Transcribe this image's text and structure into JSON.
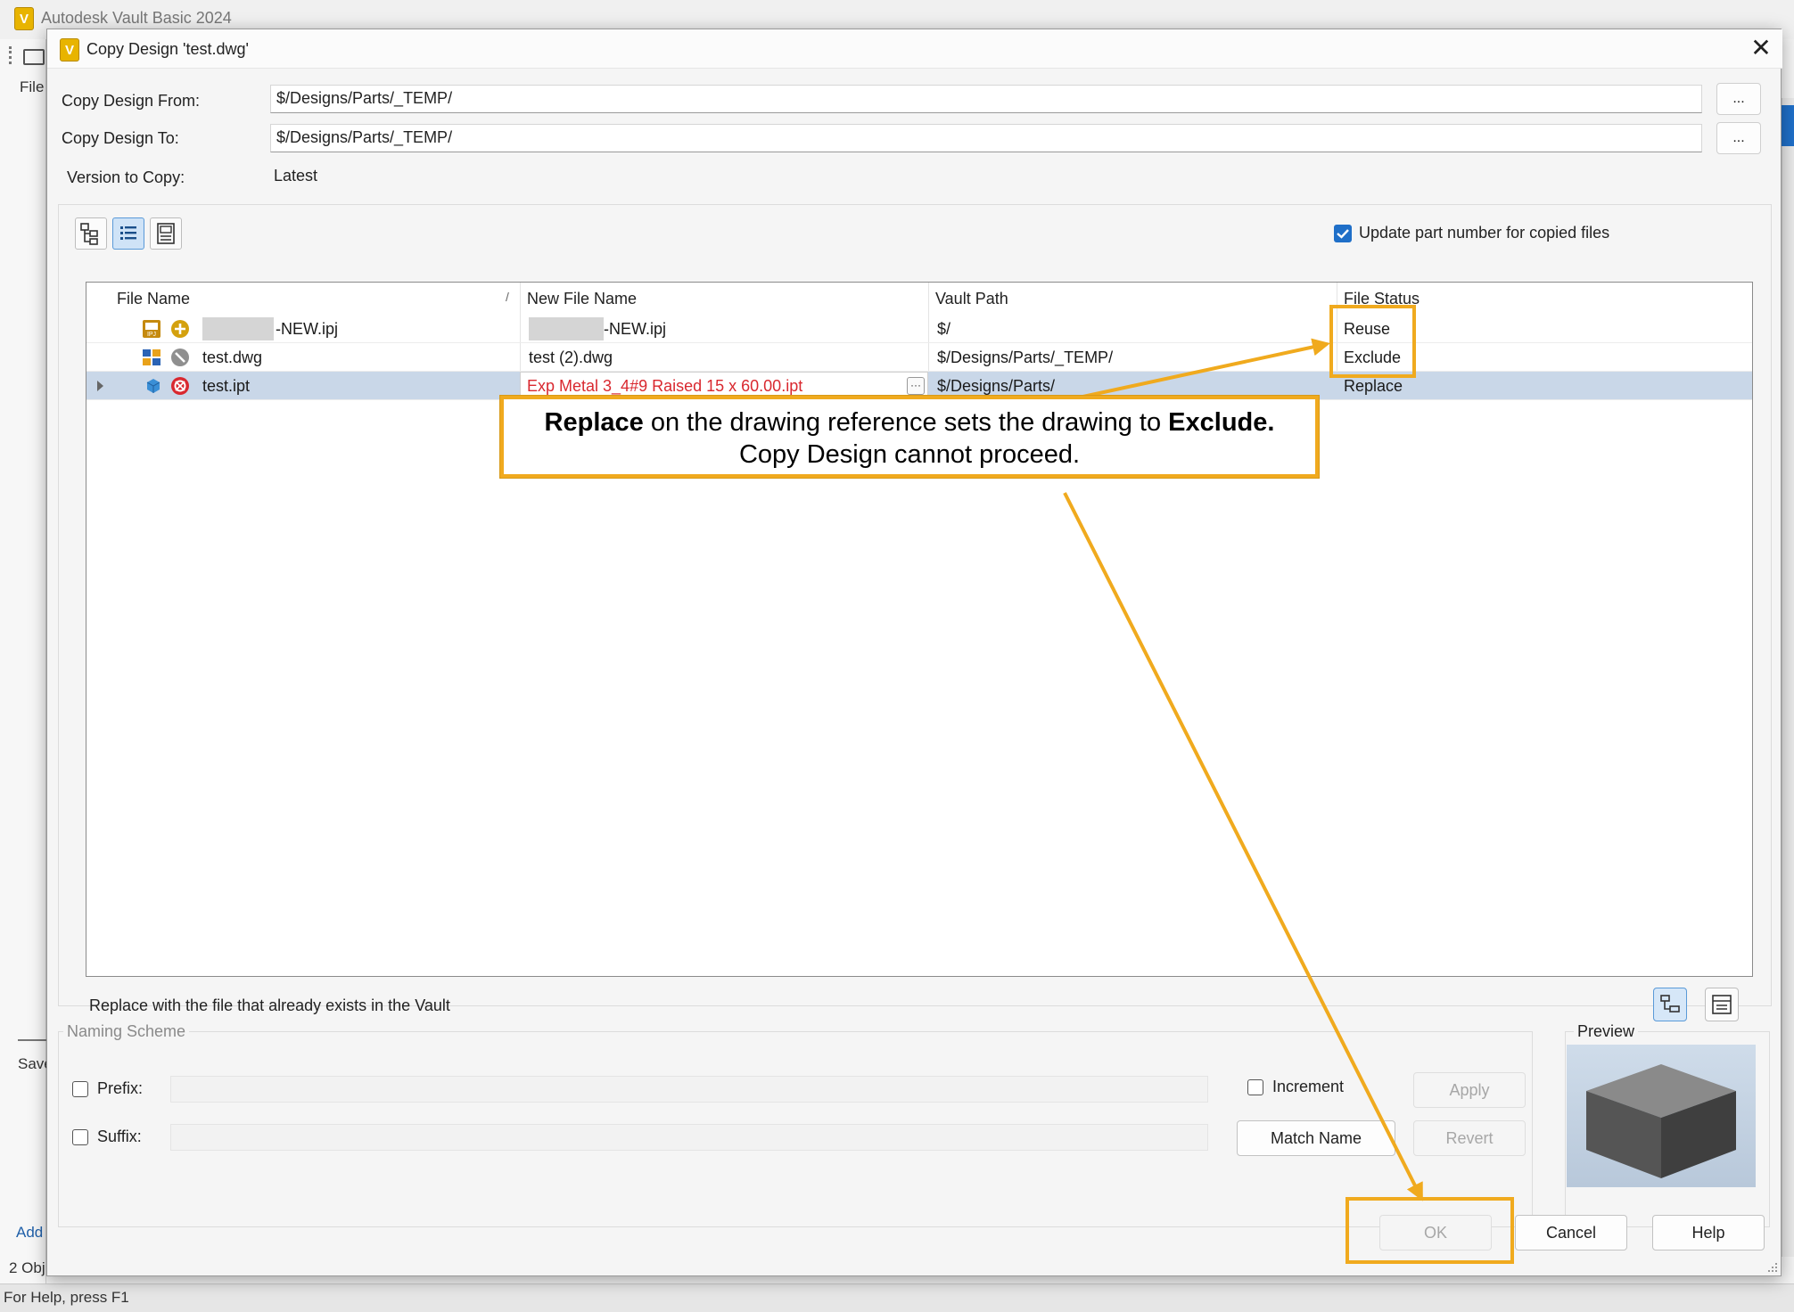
{
  "background_app": {
    "title": "Autodesk Vault Basic 2024",
    "file_menu": "File",
    "save_fragment": "Save",
    "add_fragment": "Add",
    "objects_fragment": "2 Obj",
    "status_bar": "For Help, press F1"
  },
  "dialog": {
    "title": "Copy Design 'test.dwg'",
    "close_glyph": "✕",
    "copy_from_label": "Copy Design From:",
    "copy_from_value": "$/Designs/Parts/_TEMP/",
    "copy_to_label": "Copy Design To:",
    "copy_to_value": "$/Designs/Parts/_TEMP/",
    "browse_label": "...",
    "version_label": "Version to Copy:",
    "version_value": "Latest",
    "update_part_number_label": "Update part number for copied files",
    "update_part_number_checked": true
  },
  "grid": {
    "headers": {
      "file_name": "File Name",
      "sort_glyph": "/",
      "new_file_name": "New File Name",
      "vault_path": "Vault Path",
      "file_status": "File Status"
    },
    "rows": [
      {
        "file_name": "-NEW.ipj",
        "new_file_name": "-NEW.ipj",
        "vault_path": "$/",
        "file_status": "Reuse",
        "file_icon": "project-file-icon",
        "status_icon": "reuse-status-icon"
      },
      {
        "file_name": "test.dwg",
        "new_file_name": "test (2).dwg",
        "vault_path": "$/Designs/Parts/_TEMP/",
        "file_status": "Exclude",
        "file_icon": "drawing-file-icon",
        "status_icon": "exclude-status-icon"
      },
      {
        "file_name": "test.ipt",
        "new_file_name": "Exp Metal 3_4#9 Raised 15 x 60.00.ipt",
        "vault_path": "$/Designs/Parts/",
        "file_status": "Replace",
        "file_icon": "part-file-icon",
        "status_icon": "replace-status-icon",
        "edit_glyph": "···"
      }
    ]
  },
  "hint_text": "Replace with the file that already exists in the Vault",
  "naming_scheme": {
    "title": "Naming Scheme",
    "prefix_label": "Prefix:",
    "suffix_label": "Suffix:",
    "increment_label": "Increment",
    "apply_label": "Apply",
    "match_name_label": "Match Name",
    "revert_label": "Revert"
  },
  "preview": {
    "title": "Preview"
  },
  "buttons": {
    "ok": "OK",
    "cancel": "Cancel",
    "help": "Help"
  },
  "annotation": {
    "bold_1": "Replace",
    "text_1": " on the drawing reference sets the drawing to ",
    "bold_2": "Exclude.",
    "line_2": "Copy Design cannot proceed."
  },
  "colors": {
    "annotation": "#f0aa1e",
    "error_text": "#d9282f",
    "selection": "#c9d7e8"
  }
}
